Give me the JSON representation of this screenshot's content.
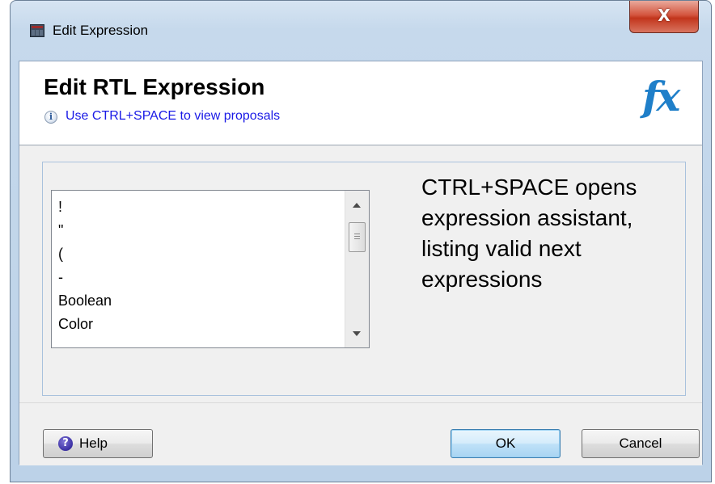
{
  "window": {
    "title": "Edit Expression",
    "close_glyph": "X",
    "icon": "app-window-icon"
  },
  "header": {
    "heading": "Edit RTL Expression",
    "hint": "Use CTRL+SPACE to view proposals",
    "info_icon": "info-icon",
    "fx_glyph": "fx"
  },
  "proposals": {
    "items": [
      "!",
      "\"",
      "(",
      "-",
      "Boolean",
      "Color"
    ]
  },
  "annotation": {
    "text": "CTRL+SPACE opens expression assistant, listing valid next expressions"
  },
  "footer": {
    "help_label": "Help",
    "help_glyph": "?",
    "ok_label": "OK",
    "cancel_label": "Cancel"
  },
  "colors": {
    "hint_link": "#1a1ae6",
    "fx_icon": "#1f7fc9",
    "close_button": "#c2351c"
  }
}
